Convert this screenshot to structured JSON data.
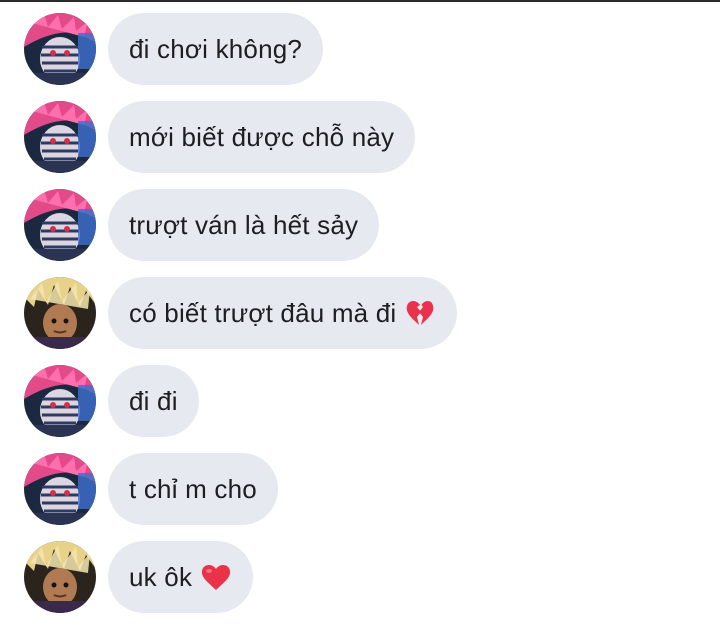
{
  "chat": {
    "messages": [
      {
        "sender": "pink-hair-user",
        "text": "đi chơi không?",
        "emoji": ""
      },
      {
        "sender": "pink-hair-user",
        "text": "mới biết được chỗ này",
        "emoji": ""
      },
      {
        "sender": "pink-hair-user",
        "text": "trượt ván là hết sảy",
        "emoji": ""
      },
      {
        "sender": "blond-hair-user",
        "text": "có biết trượt đâu mà đi",
        "emoji": "broken-heart-icon"
      },
      {
        "sender": "pink-hair-user",
        "text": "đi đi",
        "emoji": ""
      },
      {
        "sender": "pink-hair-user",
        "text": "t chỉ m cho",
        "emoji": ""
      },
      {
        "sender": "blond-hair-user",
        "text": "uk ôk",
        "emoji": "red-heart-icon"
      }
    ]
  },
  "colors": {
    "bubble": "#e6e9ef",
    "text": "#1c1e21",
    "heart": "#e8334a"
  }
}
